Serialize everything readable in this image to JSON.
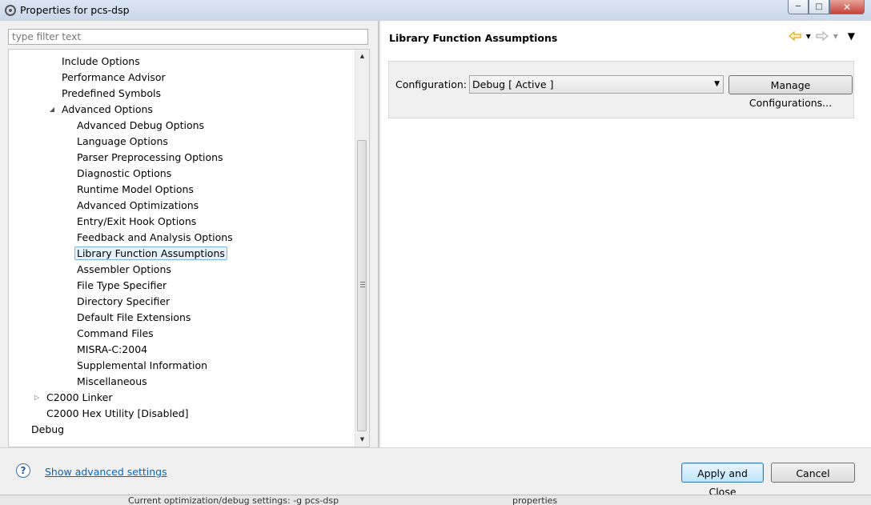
{
  "window": {
    "title": "Properties for pcs-dsp"
  },
  "filter": {
    "placeholder": "type filter text"
  },
  "tree": {
    "items": [
      {
        "label": "Include Options",
        "level": 2
      },
      {
        "label": "Performance Advisor",
        "level": 2
      },
      {
        "label": "Predefined Symbols",
        "level": 2
      },
      {
        "label": "Advanced Options",
        "level": 2,
        "twisty": "expanded"
      },
      {
        "label": "Advanced Debug Options",
        "level": 3
      },
      {
        "label": "Language Options",
        "level": 3
      },
      {
        "label": "Parser Preprocessing Options",
        "level": 3
      },
      {
        "label": "Diagnostic Options",
        "level": 3
      },
      {
        "label": "Runtime Model Options",
        "level": 3
      },
      {
        "label": "Advanced Optimizations",
        "level": 3
      },
      {
        "label": "Entry/Exit Hook Options",
        "level": 3
      },
      {
        "label": "Feedback and Analysis Options",
        "level": 3
      },
      {
        "label": "Library Function Assumptions",
        "level": 3,
        "selected": true
      },
      {
        "label": "Assembler Options",
        "level": 3
      },
      {
        "label": "File Type Specifier",
        "level": 3
      },
      {
        "label": "Directory Specifier",
        "level": 3
      },
      {
        "label": "Default File Extensions",
        "level": 3
      },
      {
        "label": "Command Files",
        "level": 3
      },
      {
        "label": "MISRA-C:2004",
        "level": 3
      },
      {
        "label": "Supplemental Information",
        "level": 3
      },
      {
        "label": "Miscellaneous",
        "level": 3
      },
      {
        "label": "C2000 Linker",
        "level": 1,
        "twisty": "collapsed"
      },
      {
        "label": "C2000 Hex Utility  [Disabled]",
        "level": 1
      },
      {
        "label": "Debug",
        "level": 0
      }
    ]
  },
  "page": {
    "title": "Library Function Assumptions",
    "config_label": "Configuration:",
    "config_value": "Debug  [ Active ]",
    "manage_label": "Manage Configurations..."
  },
  "footer": {
    "help": "?",
    "advanced_link": "Show advanced settings",
    "apply_label": "Apply and Close",
    "cancel_label": "Cancel"
  },
  "background": {
    "text_left": "Current optimization/debug settings: -g pcs-dsp",
    "text_right": "properties"
  },
  "colors": {
    "selection_bg": "#e5f1fb",
    "selection_border": "#7eb4ea",
    "link": "#0066cc",
    "nav_back_arrow": "#e8a317"
  }
}
